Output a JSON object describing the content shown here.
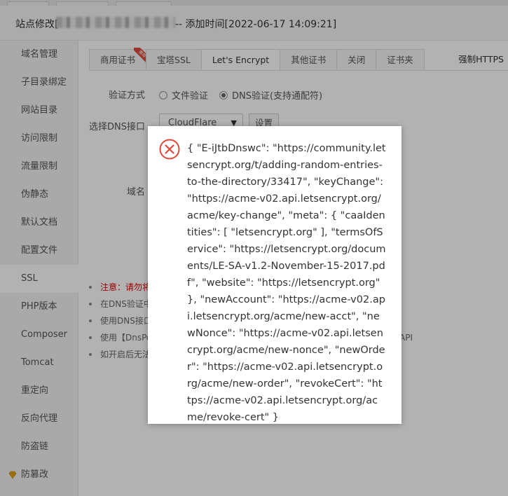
{
  "window": {
    "title_prefix": "站点修改[",
    "title_suffix": "-- 添加时间[2022-06-17 14:09:21]"
  },
  "sidebar": {
    "items": [
      {
        "label": "域名管理"
      },
      {
        "label": "子目录绑定"
      },
      {
        "label": "网站目录"
      },
      {
        "label": "访问限制"
      },
      {
        "label": "流量限制"
      },
      {
        "label": "伪静态"
      },
      {
        "label": "默认文档"
      },
      {
        "label": "配置文件"
      },
      {
        "label": "SSL"
      },
      {
        "label": "PHP版本"
      },
      {
        "label": "Composer"
      },
      {
        "label": "Tomcat"
      },
      {
        "label": "重定向"
      },
      {
        "label": "反向代理"
      },
      {
        "label": "防盗链"
      },
      {
        "label": "防篡改",
        "icon": "diamond-icon"
      }
    ],
    "active_index": 8
  },
  "tabs": {
    "items": [
      {
        "label": "商用证书",
        "badge": "推荐"
      },
      {
        "label": "宝塔SSL"
      },
      {
        "label": "Let's Encrypt"
      },
      {
        "label": "其他证书"
      },
      {
        "label": "关闭"
      },
      {
        "label": "证书夹"
      }
    ],
    "active_index": 2,
    "force_https_label": "强制HTTPS"
  },
  "form": {
    "verify_label": "验证方式",
    "verify_options": [
      {
        "label": "文件验证",
        "checked": false
      },
      {
        "label": "DNS验证(支持通配符)",
        "checked": true
      }
    ],
    "dns_label": "选择DNS接口",
    "dns_value": "CloudFlare",
    "settings_button": "设置",
    "domain_label": "域名"
  },
  "notes": [
    {
      "text": "注意：请勿将",
      "style": "red"
    },
    {
      "text": "在DNS验证中"
    },
    {
      "text": "使用DNS接口"
    },
    {
      "text": "使用【DnsPo",
      "tail": "API"
    },
    {
      "text": "如开启后无法"
    }
  ],
  "dialog": {
    "icon": "error-circle-x-icon",
    "message": "{ \"E-iJtbDnswc\": \"https://community.letsencrypt.org/t/adding-random-entries-to-the-directory/33417\", \"keyChange\": \"https://acme-v02.api.letsencrypt.org/acme/key-change\", \"meta\": { \"caaIdentities\": [ \"letsencrypt.org\" ], \"termsOfService\": \"https://letsencrypt.org/documents/LE-SA-v1.2-November-15-2017.pdf\", \"website\": \"https://letsencrypt.org\" }, \"newAccount\": \"https://acme-v02.api.letsencrypt.org/acme/new-acct\", \"newNonce\": \"https://acme-v02.api.letsencrypt.org/acme/new-nonce\", \"newOrder\": \"https://acme-v02.api.letsencrypt.org/acme/new-order\", \"revokeCert\": \"https://acme-v02.api.letsencrypt.org/acme/revoke-cert\" }",
    "error_color": "#e0483a"
  }
}
